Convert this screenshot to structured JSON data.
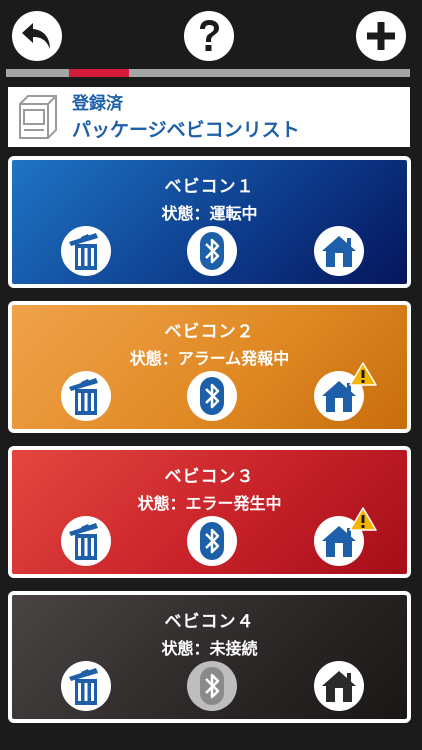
{
  "header": {
    "line1": "登録済",
    "line2": "パッケージベビコンリスト"
  },
  "icons": {
    "back": "back-arrow-icon",
    "help": "question-mark-icon",
    "add": "plus-icon",
    "header": "device-box-icon",
    "trash": "trash-icon",
    "bluetooth": "bluetooth-icon",
    "home": "home-icon",
    "warning": "warning-icon"
  },
  "colors": {
    "progress_active": "#d21a3a",
    "header_text": "#1d5fa8",
    "bluetooth_active": "#1d5fa8",
    "bluetooth_inactive": "#8a8a8a"
  },
  "devices": [
    {
      "name": "ベビコン１",
      "status": "状態：運転中",
      "warning": false
    },
    {
      "name": "ベビコン２",
      "status": "状態：アラーム発報中",
      "warning": true
    },
    {
      "name": "ベビコン３",
      "status": "状態：エラー発生中",
      "warning": true
    },
    {
      "name": "ベビコン４",
      "status": "状態：未接続",
      "warning": false
    }
  ]
}
